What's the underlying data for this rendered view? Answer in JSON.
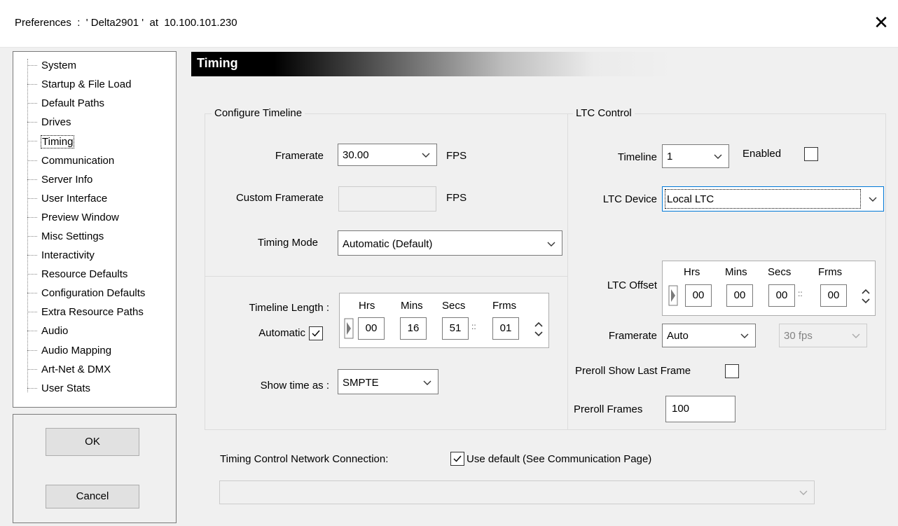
{
  "window": {
    "title": "Preferences  :  ' Delta2901 '  at  10.100.101.230"
  },
  "tree": {
    "items": [
      "System",
      "Startup & File Load",
      "Default Paths",
      "Drives",
      "Timing",
      "Communication",
      "Server Info",
      "User Interface",
      "Preview Window",
      "Misc Settings",
      "Interactivity",
      "Resource Defaults",
      "Configuration Defaults",
      "Extra Resource Paths",
      "Audio",
      "Audio Mapping",
      "Art-Net & DMX",
      "User Stats"
    ],
    "selected": "Timing"
  },
  "buttons": {
    "ok": "OK",
    "cancel": "Cancel"
  },
  "header": {
    "title": "Timing"
  },
  "configure_timeline": {
    "group_label": "Configure Timeline",
    "framerate_label": "Framerate",
    "framerate_value": "30.00",
    "fps_unit": "FPS",
    "custom_framerate_label": "Custom Framerate",
    "custom_fps_unit": "FPS",
    "timing_mode_label": "Timing Mode",
    "timing_mode_value": "Automatic (Default)",
    "timeline_length_label": "Timeline Length :",
    "automatic_label": "Automatic",
    "automatic_checked": true,
    "tc_headers": [
      "Hrs",
      "Mins",
      "Secs",
      "Frms"
    ],
    "tc_values": [
      "00",
      "16",
      "51",
      "01"
    ],
    "tc_separator": "::",
    "show_time_label": "Show time as :",
    "show_time_value": "SMPTE"
  },
  "ltc_control": {
    "group_label": "LTC Control",
    "timeline_label": "Timeline",
    "timeline_value": "1",
    "enabled_label": "Enabled",
    "enabled_checked": false,
    "ltc_device_label": "LTC Device",
    "ltc_device_value": "Local LTC",
    "ltc_offset_label": "LTC Offset",
    "tc_headers": [
      "Hrs",
      "Mins",
      "Secs",
      "Frms"
    ],
    "tc_values": [
      "00",
      "00",
      "00",
      "00"
    ],
    "tc_separator": "::",
    "framerate_label": "Framerate",
    "framerate_value": "Auto",
    "fps_value": "30 fps",
    "preroll_show_last_label": "Preroll Show Last Frame",
    "preroll_show_last_checked": false,
    "preroll_frames_label": "Preroll Frames",
    "preroll_frames_value": "100"
  },
  "network": {
    "label": "Timing Control Network Connection:",
    "use_default_label": "Use default (See Communication Page)",
    "use_default_checked": true,
    "connection_value": ""
  },
  "colors": {
    "header_start": "#000000",
    "selection_border": "#000000"
  }
}
